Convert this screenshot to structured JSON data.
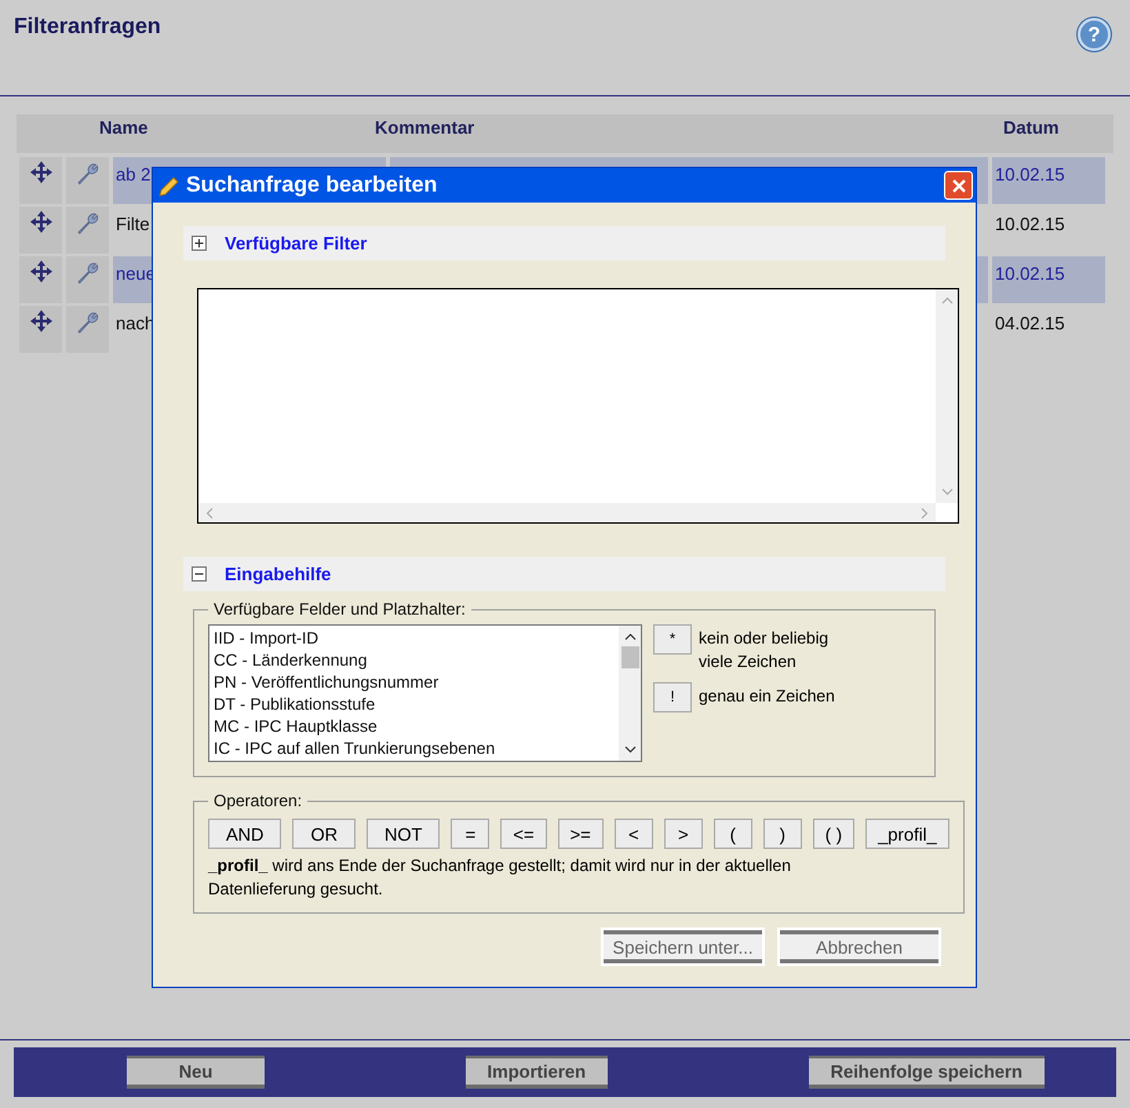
{
  "page": {
    "title": "Filteranfragen",
    "help": "?"
  },
  "table": {
    "columns": [
      "Name",
      "Kommentar",
      "Datum"
    ],
    "rows": [
      {
        "name": "ab 2",
        "date": "10.02.15",
        "selected": true
      },
      {
        "name": "Filte",
        "date": "10.02.15",
        "selected": false
      },
      {
        "name": "neue",
        "date": "10.02.15",
        "selected": true
      },
      {
        "name": "nach",
        "date": "04.02.15",
        "selected": false
      }
    ]
  },
  "dialog": {
    "title": "Suchanfrage bearbeiten",
    "sections": [
      {
        "title": "Verfügbare Filter",
        "expanded": false
      },
      {
        "title": "Eingabehilfe",
        "expanded": true
      }
    ],
    "fields": {
      "legend": "Verfügbare Felder und Platzhalter:",
      "items": [
        "IID - Import-ID",
        "CC - Länderkennung",
        "PN - Veröffentlichungsnummer",
        "DT - Publikationsstufe",
        "MC - IPC Hauptklasse",
        "IC - IPC auf allen Trunkierungsebenen"
      ],
      "wildcards": [
        {
          "key": "*",
          "description": "kein oder beliebig viele Zeichen"
        },
        {
          "key": "!",
          "description": "genau ein Zeichen"
        }
      ]
    },
    "operators": {
      "legend": "Operatoren:",
      "buttons": [
        "AND",
        "OR",
        "NOT",
        "=",
        "<=",
        ">=",
        "<",
        ">",
        "(",
        ")",
        "( )",
        "_profil_"
      ],
      "note": "**_profil_** wird ans Ende der Suchanfrage gestellt; damit wird nur in der aktuellen Datenlieferung gesucht."
    },
    "buttons": [
      "Speichern unter...",
      "Abbrechen"
    ]
  },
  "footer": {
    "buttons": [
      "Neu",
      "Importieren",
      "Reihenfolge speichern"
    ]
  }
}
